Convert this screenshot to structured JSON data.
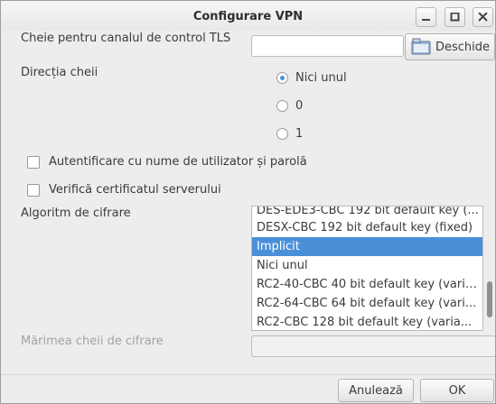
{
  "window": {
    "title": "Configurare VPN"
  },
  "tls_key": {
    "label": "Cheie pentru canalul de control TLS",
    "value": "",
    "open_button": "Deschide"
  },
  "key_direction": {
    "label": "Direcția cheii",
    "options": [
      "Nici unul",
      "0",
      "1"
    ],
    "selected": "Nici unul"
  },
  "checkboxes": {
    "auth": {
      "label": "Autentificare cu nume de utilizator și parolă",
      "checked": false
    },
    "verify": {
      "label": "Verifică certificatul serverului",
      "checked": false
    }
  },
  "cipher": {
    "label": "Algoritm de cifrare",
    "items": [
      "DES-EDE3-CBC 192 bit default key (...",
      "DESX-CBC 192 bit default key (fixed)",
      "Implicit",
      "Nici unul",
      "RC2-40-CBC 40 bit default key (varia...",
      "RC2-64-CBC 64 bit default key (vari...",
      "RC2-CBC 128 bit default key (varia..."
    ],
    "selected": "Implicit"
  },
  "key_size": {
    "label": "Mărimea cheii de cifrare",
    "value": ""
  },
  "buttons": {
    "cancel": "Anulează",
    "ok": "OK"
  },
  "colors": {
    "selection": "#4a90d9",
    "window_bg": "#ededed"
  }
}
